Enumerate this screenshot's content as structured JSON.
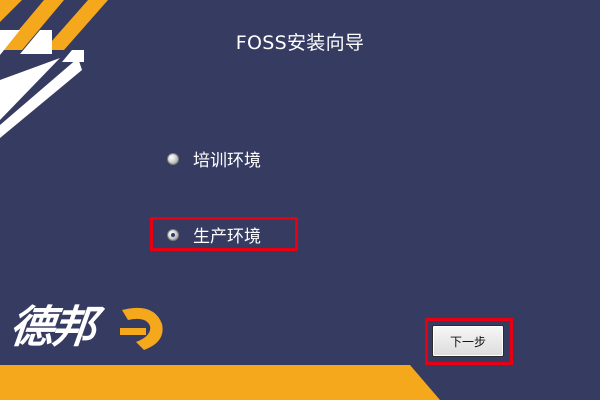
{
  "window": {
    "title": "FOSS安装向导"
  },
  "options": [
    {
      "label": "培训环境",
      "selected": false
    },
    {
      "label": "生产环境",
      "selected": true
    }
  ],
  "buttons": {
    "next_label": "下一步"
  },
  "brand": {
    "logo_text": "德邦"
  },
  "colors": {
    "background": "#363b62",
    "accent_yellow": "#f5a81c",
    "highlight_red": "#e60012"
  }
}
